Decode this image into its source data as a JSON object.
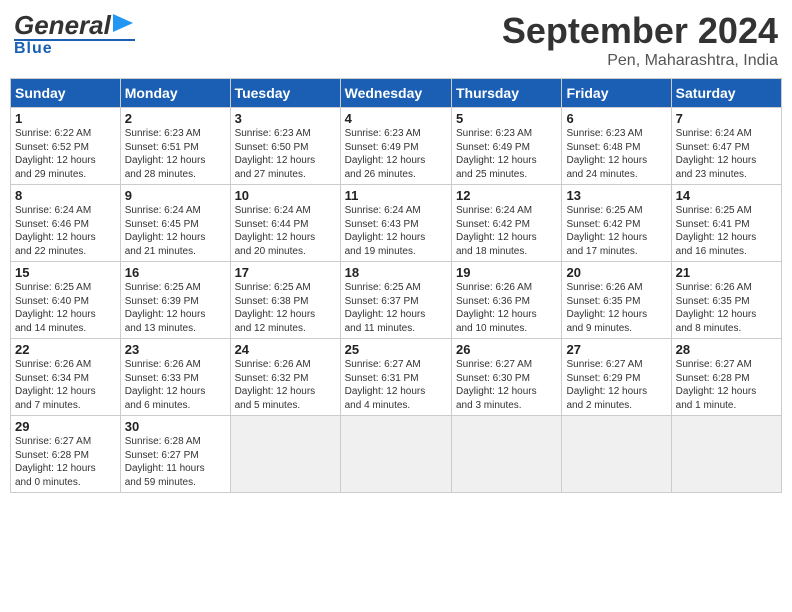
{
  "header": {
    "logo_general": "General",
    "logo_blue": "Blue",
    "month": "September 2024",
    "location": "Pen, Maharashtra, India"
  },
  "weekdays": [
    "Sunday",
    "Monday",
    "Tuesday",
    "Wednesday",
    "Thursday",
    "Friday",
    "Saturday"
  ],
  "weeks": [
    [
      {
        "day": "1",
        "info": "Sunrise: 6:22 AM\nSunset: 6:52 PM\nDaylight: 12 hours\nand 29 minutes."
      },
      {
        "day": "2",
        "info": "Sunrise: 6:23 AM\nSunset: 6:51 PM\nDaylight: 12 hours\nand 28 minutes."
      },
      {
        "day": "3",
        "info": "Sunrise: 6:23 AM\nSunset: 6:50 PM\nDaylight: 12 hours\nand 27 minutes."
      },
      {
        "day": "4",
        "info": "Sunrise: 6:23 AM\nSunset: 6:49 PM\nDaylight: 12 hours\nand 26 minutes."
      },
      {
        "day": "5",
        "info": "Sunrise: 6:23 AM\nSunset: 6:49 PM\nDaylight: 12 hours\nand 25 minutes."
      },
      {
        "day": "6",
        "info": "Sunrise: 6:23 AM\nSunset: 6:48 PM\nDaylight: 12 hours\nand 24 minutes."
      },
      {
        "day": "7",
        "info": "Sunrise: 6:24 AM\nSunset: 6:47 PM\nDaylight: 12 hours\nand 23 minutes."
      }
    ],
    [
      {
        "day": "8",
        "info": "Sunrise: 6:24 AM\nSunset: 6:46 PM\nDaylight: 12 hours\nand 22 minutes."
      },
      {
        "day": "9",
        "info": "Sunrise: 6:24 AM\nSunset: 6:45 PM\nDaylight: 12 hours\nand 21 minutes."
      },
      {
        "day": "10",
        "info": "Sunrise: 6:24 AM\nSunset: 6:44 PM\nDaylight: 12 hours\nand 20 minutes."
      },
      {
        "day": "11",
        "info": "Sunrise: 6:24 AM\nSunset: 6:43 PM\nDaylight: 12 hours\nand 19 minutes."
      },
      {
        "day": "12",
        "info": "Sunrise: 6:24 AM\nSunset: 6:42 PM\nDaylight: 12 hours\nand 18 minutes."
      },
      {
        "day": "13",
        "info": "Sunrise: 6:25 AM\nSunset: 6:42 PM\nDaylight: 12 hours\nand 17 minutes."
      },
      {
        "day": "14",
        "info": "Sunrise: 6:25 AM\nSunset: 6:41 PM\nDaylight: 12 hours\nand 16 minutes."
      }
    ],
    [
      {
        "day": "15",
        "info": "Sunrise: 6:25 AM\nSunset: 6:40 PM\nDaylight: 12 hours\nand 14 minutes."
      },
      {
        "day": "16",
        "info": "Sunrise: 6:25 AM\nSunset: 6:39 PM\nDaylight: 12 hours\nand 13 minutes."
      },
      {
        "day": "17",
        "info": "Sunrise: 6:25 AM\nSunset: 6:38 PM\nDaylight: 12 hours\nand 12 minutes."
      },
      {
        "day": "18",
        "info": "Sunrise: 6:25 AM\nSunset: 6:37 PM\nDaylight: 12 hours\nand 11 minutes."
      },
      {
        "day": "19",
        "info": "Sunrise: 6:26 AM\nSunset: 6:36 PM\nDaylight: 12 hours\nand 10 minutes."
      },
      {
        "day": "20",
        "info": "Sunrise: 6:26 AM\nSunset: 6:35 PM\nDaylight: 12 hours\nand 9 minutes."
      },
      {
        "day": "21",
        "info": "Sunrise: 6:26 AM\nSunset: 6:35 PM\nDaylight: 12 hours\nand 8 minutes."
      }
    ],
    [
      {
        "day": "22",
        "info": "Sunrise: 6:26 AM\nSunset: 6:34 PM\nDaylight: 12 hours\nand 7 minutes."
      },
      {
        "day": "23",
        "info": "Sunrise: 6:26 AM\nSunset: 6:33 PM\nDaylight: 12 hours\nand 6 minutes."
      },
      {
        "day": "24",
        "info": "Sunrise: 6:26 AM\nSunset: 6:32 PM\nDaylight: 12 hours\nand 5 minutes."
      },
      {
        "day": "25",
        "info": "Sunrise: 6:27 AM\nSunset: 6:31 PM\nDaylight: 12 hours\nand 4 minutes."
      },
      {
        "day": "26",
        "info": "Sunrise: 6:27 AM\nSunset: 6:30 PM\nDaylight: 12 hours\nand 3 minutes."
      },
      {
        "day": "27",
        "info": "Sunrise: 6:27 AM\nSunset: 6:29 PM\nDaylight: 12 hours\nand 2 minutes."
      },
      {
        "day": "28",
        "info": "Sunrise: 6:27 AM\nSunset: 6:28 PM\nDaylight: 12 hours\nand 1 minute."
      }
    ],
    [
      {
        "day": "29",
        "info": "Sunrise: 6:27 AM\nSunset: 6:28 PM\nDaylight: 12 hours\nand 0 minutes."
      },
      {
        "day": "30",
        "info": "Sunrise: 6:28 AM\nSunset: 6:27 PM\nDaylight: 11 hours\nand 59 minutes."
      },
      {
        "day": "",
        "info": ""
      },
      {
        "day": "",
        "info": ""
      },
      {
        "day": "",
        "info": ""
      },
      {
        "day": "",
        "info": ""
      },
      {
        "day": "",
        "info": ""
      }
    ]
  ]
}
